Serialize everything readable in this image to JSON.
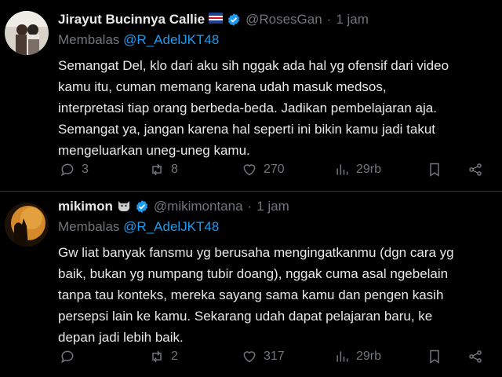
{
  "tweets": [
    {
      "name": "Jirayut Bucinnya Callie",
      "handle": "@RosesGan",
      "separator": "·",
      "time": "1 jam",
      "reply_prefix": "Membalas",
      "reply_to": "@R_AdelJKT48",
      "text": "Semangat Del, klo dari aku sih nggak ada hal yg ofensif dari video\nkamu itu, cuman memang karena udah masuk medsos,\ninterpretasi tiap orang berbeda-beda. Jadikan pembelajaran aja.\nSemangat ya, jangan karena hal seperti ini bikin kamu jadi takut\nmengeluarkan uneg-uneg kamu.",
      "replies": "3",
      "reposts": "8",
      "likes": "270",
      "views": "29rb",
      "icons": [
        "reply-icon",
        "repost-icon",
        "like-icon",
        "views-icon",
        "bookmark-icon",
        "share-icon"
      ]
    },
    {
      "name": "mikimon",
      "handle": "@mikimontana",
      "separator": "·",
      "time": "1 jam",
      "reply_prefix": "Membalas",
      "reply_to": "@R_AdelJKT48",
      "text": "Gw liat banyak fansmu yg berusaha mengingatkanmu (dgn cara yg\nbaik, bukan yg numpang tubir doang), nggak cuma asal ngebelain\ntanpa tau konteks, mereka sayang sama kamu dan pengen kasih\npersepsi lain ke kamu. Sekarang udah dapat pelajaran baru, ke\ndepan jadi lebih baik.",
      "replies": "",
      "reposts": "2",
      "likes": "317",
      "views": "29rb",
      "icons": [
        "reply-icon",
        "repost-icon",
        "like-icon",
        "views-icon",
        "bookmark-icon",
        "share-icon"
      ]
    }
  ],
  "colors": {
    "background": "#000000",
    "text": "#e7e9ea",
    "muted": "#71767b",
    "accent": "#1d9bf0",
    "divider": "#2f3336"
  }
}
